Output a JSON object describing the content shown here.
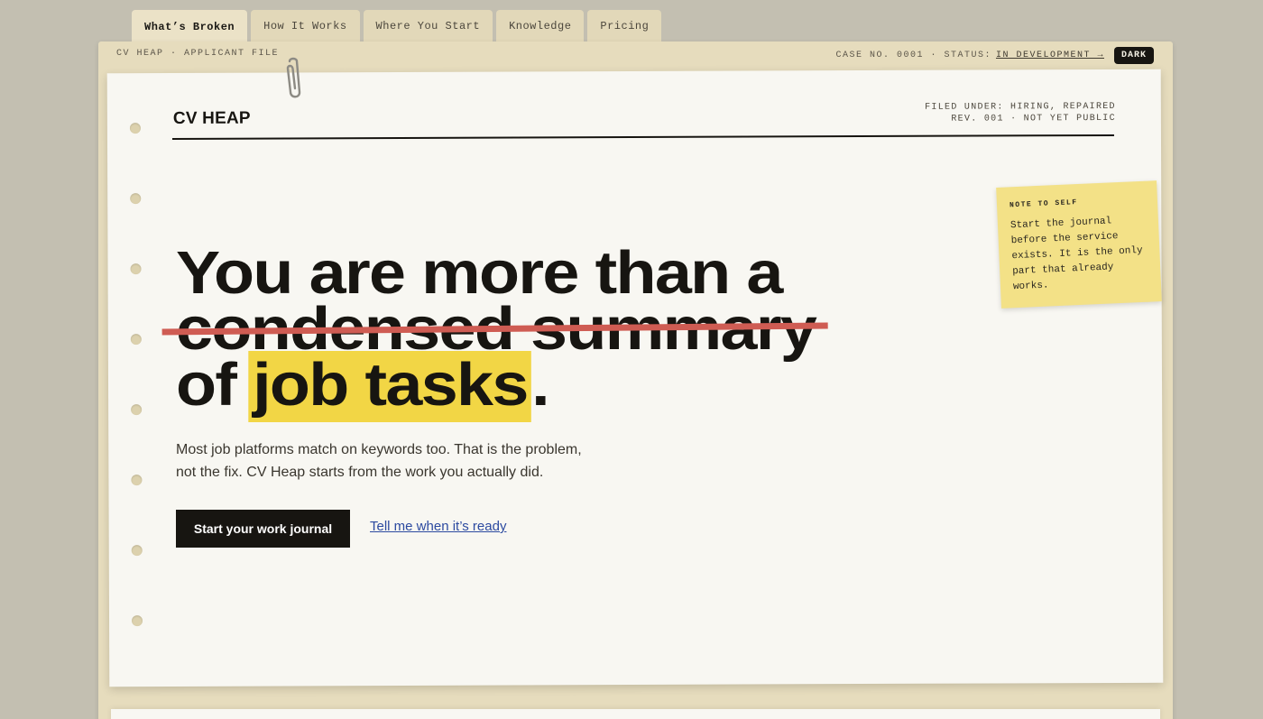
{
  "tabs": [
    {
      "label": "What’s Broken",
      "active": true
    },
    {
      "label": "How It Works"
    },
    {
      "label": "Where You Start"
    },
    {
      "label": "Knowledge"
    },
    {
      "label": "Pricing"
    }
  ],
  "folder": {
    "label": "CV HEAP · APPLICANT FILE",
    "case_prefix": "CASE NO. 0001 · STATUS:",
    "status_link": "IN DEVELOPMENT →",
    "theme_button": "DARK"
  },
  "paper": {
    "brand": "CV HEAP",
    "filed_line1": "FILED UNDER: HIRING, REPAIRED",
    "filed_line2": "REV. 001 · NOT YET PUBLIC"
  },
  "sticky": {
    "title": "NOTE TO SELF",
    "lines": [
      "Start the journal",
      "before the service",
      "exists. It is the only",
      "part that already",
      "works."
    ]
  },
  "headline": {
    "line1": "You are more than a",
    "struck": "condensed summary",
    "line3_prefix": "of ",
    "highlight": "job tasks",
    "line3_suffix": "."
  },
  "subtitle": {
    "line1": "Most job platforms match on keywords too. That is the problem,",
    "line2": "not the fix. CV Heap starts from the work you actually did."
  },
  "cta": {
    "primary": "Start your work journal",
    "secondary": "Tell me when it’s ready"
  },
  "colors": {
    "background": "#c3bfb1",
    "folder": "#e6dcbd",
    "paper": "#f8f7f2",
    "highlight": "#f2d645",
    "strike": "#cf5c53",
    "link": "#2c4aa0"
  }
}
